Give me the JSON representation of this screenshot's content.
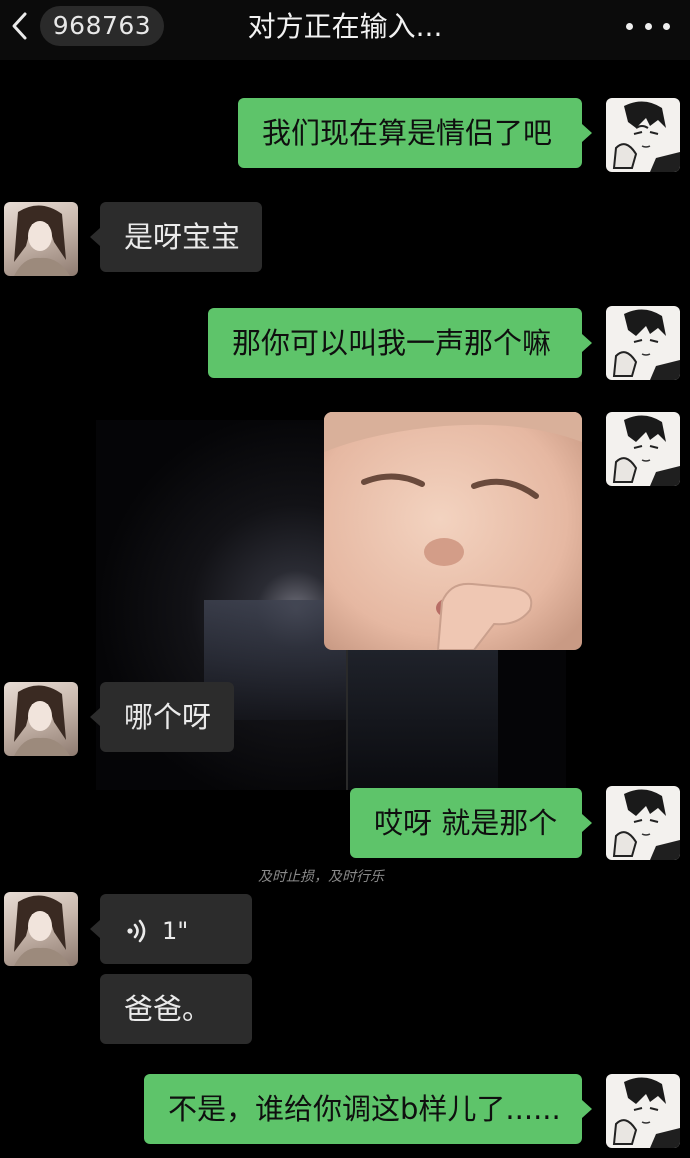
{
  "header": {
    "back_icon": "chevron-left-icon",
    "unread_count": "968763",
    "title": "对方正在输入...",
    "more_icon": "ellipsis-icon"
  },
  "colors": {
    "background": "#000000",
    "my_bubble": "#5ec46a",
    "her_bubble": "#2c2c2c"
  },
  "background_caption": "及时止损，及时行乐",
  "messages": [
    {
      "sender": "me",
      "text": "我们现在算是情侣了吧"
    },
    {
      "sender": "her",
      "text": "是呀宝宝"
    },
    {
      "sender": "me",
      "text": "那你可以叫我一声那个嘛"
    },
    {
      "sender": "me",
      "type": "sticker",
      "icon": "child-face-sticker"
    },
    {
      "sender": "her",
      "text": "哪个呀"
    },
    {
      "sender": "me",
      "text": "哎呀 就是那个"
    },
    {
      "sender": "her",
      "type": "voice",
      "duration": "1\"",
      "icon": "voice-wave-icon"
    },
    {
      "sender": "her",
      "text": "爸爸。"
    },
    {
      "sender": "me",
      "text": "不是，谁给你调这b样儿了......"
    }
  ]
}
